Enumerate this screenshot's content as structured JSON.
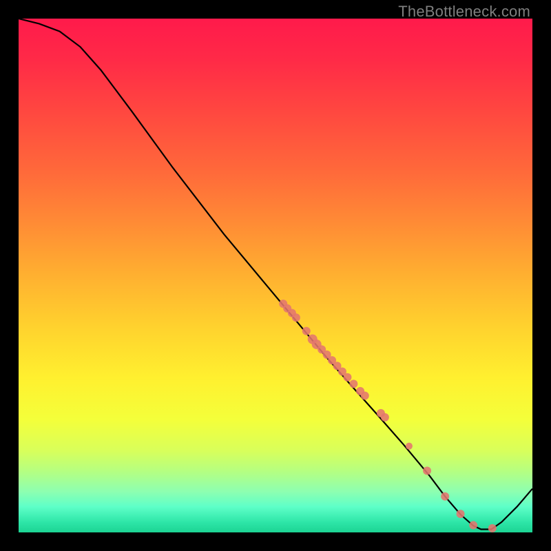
{
  "watermark": "TheBottleneck.com",
  "chart_data": {
    "type": "line",
    "xlabel": "",
    "ylabel": "",
    "xlim": [
      0,
      100
    ],
    "ylim": [
      0,
      100
    ],
    "curve": [
      {
        "x": 0,
        "y": 100
      },
      {
        "x": 4,
        "y": 99
      },
      {
        "x": 8,
        "y": 97.5
      },
      {
        "x": 12,
        "y": 94.5
      },
      {
        "x": 16,
        "y": 90
      },
      {
        "x": 22,
        "y": 82
      },
      {
        "x": 30,
        "y": 71
      },
      {
        "x": 40,
        "y": 58
      },
      {
        "x": 50,
        "y": 46
      },
      {
        "x": 55,
        "y": 40
      },
      {
        "x": 60,
        "y": 34
      },
      {
        "x": 65,
        "y": 28.3
      },
      {
        "x": 70,
        "y": 22.7
      },
      {
        "x": 75,
        "y": 17
      },
      {
        "x": 80,
        "y": 11
      },
      {
        "x": 83,
        "y": 7
      },
      {
        "x": 86,
        "y": 3.5
      },
      {
        "x": 88.5,
        "y": 1.3
      },
      {
        "x": 90,
        "y": 0.6
      },
      {
        "x": 92,
        "y": 0.6
      },
      {
        "x": 94,
        "y": 2.0
      },
      {
        "x": 97,
        "y": 5.0
      },
      {
        "x": 100,
        "y": 8.5
      }
    ],
    "markers": [
      {
        "x": 51.5,
        "y": 44.5,
        "r": 6
      },
      {
        "x": 52.3,
        "y": 43.6,
        "r": 6
      },
      {
        "x": 53.2,
        "y": 42.7,
        "r": 6
      },
      {
        "x": 54.0,
        "y": 41.8,
        "r": 6
      },
      {
        "x": 56.0,
        "y": 39.2,
        "r": 6
      },
      {
        "x": 57.2,
        "y": 37.6,
        "r": 7
      },
      {
        "x": 58.0,
        "y": 36.6,
        "r": 7
      },
      {
        "x": 59.0,
        "y": 35.6,
        "r": 6
      },
      {
        "x": 60.0,
        "y": 34.6,
        "r": 6
      },
      {
        "x": 61.0,
        "y": 33.5,
        "r": 6
      },
      {
        "x": 62.0,
        "y": 32.4,
        "r": 6
      },
      {
        "x": 63.0,
        "y": 31.3,
        "r": 6
      },
      {
        "x": 64.0,
        "y": 30.2,
        "r": 6
      },
      {
        "x": 65.2,
        "y": 28.9,
        "r": 6
      },
      {
        "x": 66.5,
        "y": 27.5,
        "r": 6
      },
      {
        "x": 67.4,
        "y": 26.6,
        "r": 6
      },
      {
        "x": 70.5,
        "y": 23.2,
        "r": 6
      },
      {
        "x": 71.3,
        "y": 22.4,
        "r": 6
      },
      {
        "x": 76.0,
        "y": 16.8,
        "r": 5
      },
      {
        "x": 79.5,
        "y": 12.0,
        "r": 6
      },
      {
        "x": 83.0,
        "y": 7.0,
        "r": 6
      },
      {
        "x": 86.0,
        "y": 3.6,
        "r": 6
      },
      {
        "x": 88.5,
        "y": 1.4,
        "r": 6
      },
      {
        "x": 92.2,
        "y": 0.8,
        "r": 6
      }
    ],
    "colors": {
      "curve": "#000000",
      "marker_fill": "#e4766e",
      "marker_stroke": "#e4766e"
    }
  }
}
